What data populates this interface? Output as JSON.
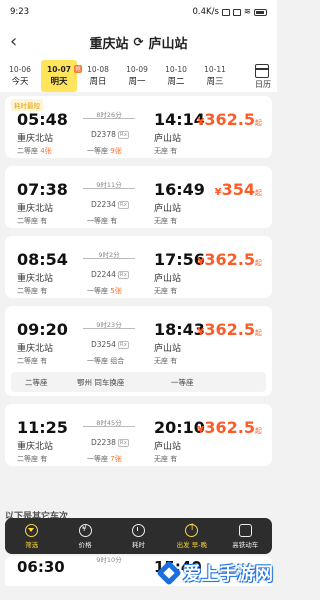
{
  "status": {
    "time": "9:23",
    "speed": "0.4K/s",
    "battery": "100"
  },
  "header": {
    "from": "重庆站",
    "to": "庐山站"
  },
  "dates": [
    {
      "date": "10-06",
      "week": "今天",
      "active": false
    },
    {
      "date": "10-07",
      "badge": "抢",
      "week": "明天",
      "active": true
    },
    {
      "date": "10-08",
      "week": "周日",
      "active": false
    },
    {
      "date": "10-09",
      "week": "周一",
      "active": false
    },
    {
      "date": "10-10",
      "week": "周二",
      "active": false
    },
    {
      "date": "10-11",
      "week": "周三",
      "active": false
    }
  ],
  "calendar_label": "日历",
  "trains": [
    {
      "tag": "耗时最短",
      "dep": "05:48",
      "arr": "14:14",
      "from": "重庆北站",
      "to": "庐山站",
      "duration": "8时26分",
      "no": "D2378",
      "price": "362.5",
      "seats": [
        {
          "t": "二等座 ",
          "v": "4张",
          "warn": true
        },
        {
          "t": "一等座 ",
          "v": "9张",
          "warn": true
        },
        {
          "t": "无座 ",
          "v": "有",
          "warn": false
        }
      ]
    },
    {
      "dep": "07:38",
      "arr": "16:49",
      "from": "重庆北站",
      "to": "庐山站",
      "duration": "9时11分",
      "no": "D2234",
      "price": "354",
      "seats": [
        {
          "t": "二等座 ",
          "v": "有",
          "warn": false
        },
        {
          "t": "一等座 ",
          "v": "有",
          "warn": false
        },
        {
          "t": "无座 ",
          "v": "有",
          "warn": false
        }
      ]
    },
    {
      "dep": "08:54",
      "arr": "17:56",
      "from": "重庆北站",
      "to": "庐山站",
      "duration": "9时2分",
      "no": "D2244",
      "price": "362.5",
      "seats": [
        {
          "t": "二等座 ",
          "v": "有",
          "warn": false
        },
        {
          "t": "一等座 ",
          "v": "5张",
          "warn": true
        },
        {
          "t": "无座 ",
          "v": "有",
          "warn": false
        }
      ]
    },
    {
      "dep": "09:20",
      "arr": "18:43",
      "from": "重庆北站",
      "to": "庐山站",
      "duration": "9时23分",
      "no": "D3254",
      "price": "362.5",
      "seats": [
        {
          "t": "二等座 ",
          "v": "有",
          "warn": false
        },
        {
          "t": "一等座 ",
          "v": "组合",
          "warn": false
        },
        {
          "t": "无座 ",
          "v": "有",
          "warn": false
        }
      ],
      "transfer": {
        "left": "二等座",
        "mid": "鄂州 同车换座",
        "right": "一等座"
      }
    },
    {
      "dep": "11:25",
      "arr": "20:10",
      "from": "重庆北站",
      "to": "庐山站",
      "duration": "8时45分",
      "no": "D2238",
      "price": "362.5",
      "seats": [
        {
          "t": "二等座 ",
          "v": "有",
          "warn": false
        },
        {
          "t": "一等座 ",
          "v": "7张",
          "warn": true
        },
        {
          "t": "无座 ",
          "v": "有",
          "warn": false
        }
      ]
    }
  ],
  "behind_text": "以下是其它车次",
  "peek": {
    "dep": "06:30",
    "arr": "15:40",
    "duration": "9时10分"
  },
  "bottom": [
    {
      "label": "筛选",
      "hl": true
    },
    {
      "label": "价格"
    },
    {
      "label": "耗时"
    },
    {
      "label": "出发 早-晚",
      "hl": true
    },
    {
      "label": "高铁动车"
    }
  ],
  "price_symbol": "¥",
  "price_suffix": "起",
  "watermark": "爱上手游网"
}
